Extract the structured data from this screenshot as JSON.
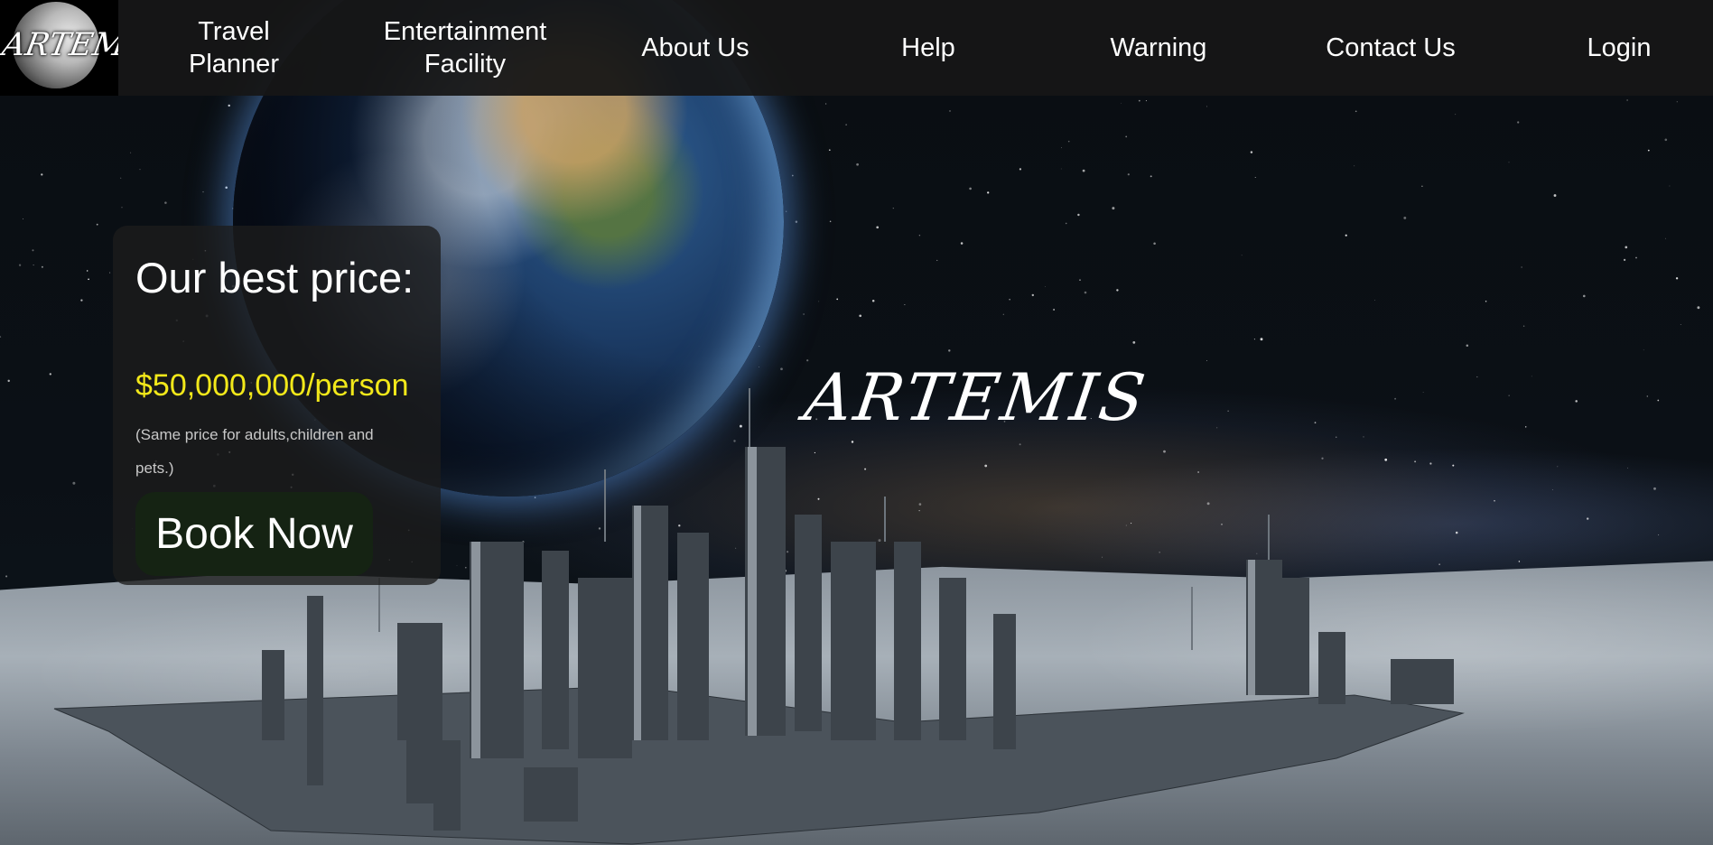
{
  "site": {
    "logo_text": "ARTEMIS",
    "hero_title": "ARTEMIS"
  },
  "nav": {
    "items": [
      {
        "line1": "Travel",
        "line2": "Planner"
      },
      {
        "line1": "Entertainment",
        "line2": "Facility"
      },
      {
        "line1": "About Us",
        "line2": ""
      },
      {
        "line1": "Help",
        "line2": ""
      },
      {
        "line1": "Warning",
        "line2": ""
      },
      {
        "line1": "Contact Us",
        "line2": ""
      },
      {
        "line1": "Login",
        "line2": ""
      }
    ]
  },
  "price_box": {
    "heading": "Our best price:",
    "price": "$50,000,000/person",
    "note": "(Same price for adults,children and pets.)",
    "button_label": "Book Now"
  },
  "colors": {
    "nav_bg": "#161616",
    "price_accent": "#f2e81a",
    "button_bg": "#152313"
  }
}
